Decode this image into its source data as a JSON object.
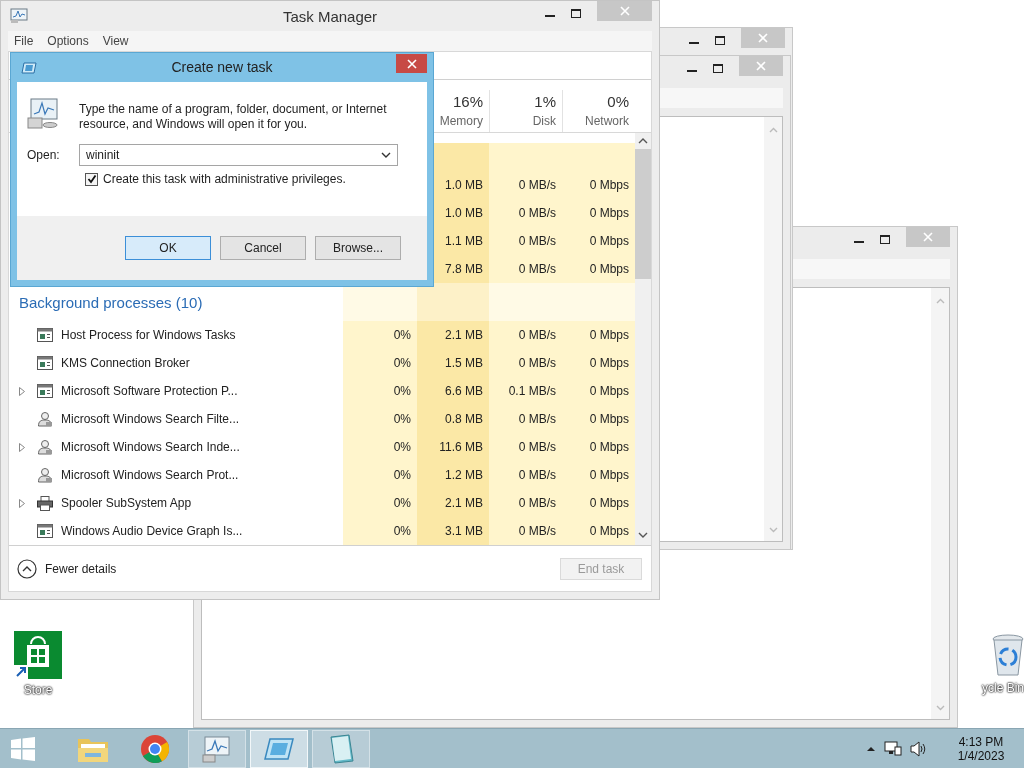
{
  "desktop": {
    "icons": [
      {
        "kind": "store",
        "label": "Store"
      },
      {
        "kind": "recycle",
        "label": "ycle Bin"
      }
    ]
  },
  "task_manager": {
    "title": "Task Manager",
    "menu": [
      "File",
      "Options",
      "View"
    ],
    "columns": [
      {
        "percent": "16%",
        "label": "Memory"
      },
      {
        "percent": "1%",
        "label": "Disk"
      },
      {
        "percent": "0%",
        "label": "Network"
      }
    ],
    "app_rows": [
      {
        "memory": "1.0 MB",
        "disk": "0 MB/s",
        "network": "0 Mbps"
      },
      {
        "memory": "1.0 MB",
        "disk": "0 MB/s",
        "network": "0 Mbps"
      },
      {
        "memory": "1.1 MB",
        "disk": "0 MB/s",
        "network": "0 Mbps"
      },
      {
        "memory": "7.8 MB",
        "disk": "0 MB/s",
        "network": "0 Mbps"
      }
    ],
    "group": "Background processes (10)",
    "rows": [
      {
        "kind": "service",
        "expandable": false,
        "name": "Host Process for Windows Tasks",
        "cpu": "0%",
        "memory": "2.1 MB",
        "disk": "0 MB/s",
        "network": "0 Mbps"
      },
      {
        "kind": "service",
        "expandable": false,
        "name": "KMS Connection Broker",
        "cpu": "0%",
        "memory": "1.5 MB",
        "disk": "0 MB/s",
        "network": "0 Mbps"
      },
      {
        "kind": "service",
        "expandable": true,
        "name": "Microsoft Software Protection P...",
        "cpu": "0%",
        "memory": "6.6 MB",
        "disk": "0.1 MB/s",
        "network": "0 Mbps"
      },
      {
        "kind": "search",
        "expandable": false,
        "name": "Microsoft Windows Search Filte...",
        "cpu": "0%",
        "memory": "0.8 MB",
        "disk": "0 MB/s",
        "network": "0 Mbps"
      },
      {
        "kind": "search",
        "expandable": true,
        "name": "Microsoft Windows Search Inde...",
        "cpu": "0%",
        "memory": "11.6 MB",
        "disk": "0 MB/s",
        "network": "0 Mbps"
      },
      {
        "kind": "search",
        "expandable": false,
        "name": "Microsoft Windows Search Prot...",
        "cpu": "0%",
        "memory": "1.2 MB",
        "disk": "0 MB/s",
        "network": "0 Mbps"
      },
      {
        "kind": "printer",
        "expandable": true,
        "name": "Spooler SubSystem App",
        "cpu": "0%",
        "memory": "2.1 MB",
        "disk": "0 MB/s",
        "network": "0 Mbps"
      },
      {
        "kind": "service",
        "expandable": false,
        "name": "Windows Audio Device Graph Is...",
        "cpu": "0%",
        "memory": "3.1 MB",
        "disk": "0 MB/s",
        "network": "0 Mbps"
      }
    ],
    "fewer_details": "Fewer details",
    "end_task": {
      "label": "End task",
      "disabled": true
    }
  },
  "dialog": {
    "title": "Create new task",
    "message": "Type the name of a program, folder, document, or Internet resource, and Windows will open it for you.",
    "open_label": "Open:",
    "value": "wininit",
    "admin": {
      "label": "Create this task with administrative privileges.",
      "checked": true
    },
    "buttons": [
      {
        "label": "OK",
        "default": true
      },
      {
        "label": "Cancel",
        "default": false
      },
      {
        "label": "Browse...",
        "default": false
      }
    ]
  },
  "taskbar": {
    "items": [
      {
        "kind": "explorer",
        "running": false,
        "selected": false
      },
      {
        "kind": "chrome",
        "running": false,
        "selected": false
      },
      {
        "kind": "taskmgr",
        "running": true,
        "selected": false
      },
      {
        "kind": "run",
        "running": true,
        "selected": true
      },
      {
        "kind": "notepad",
        "running": true,
        "selected": false
      }
    ],
    "clock": {
      "time": "4:13 PM",
      "date": "1/4/2023"
    }
  }
}
